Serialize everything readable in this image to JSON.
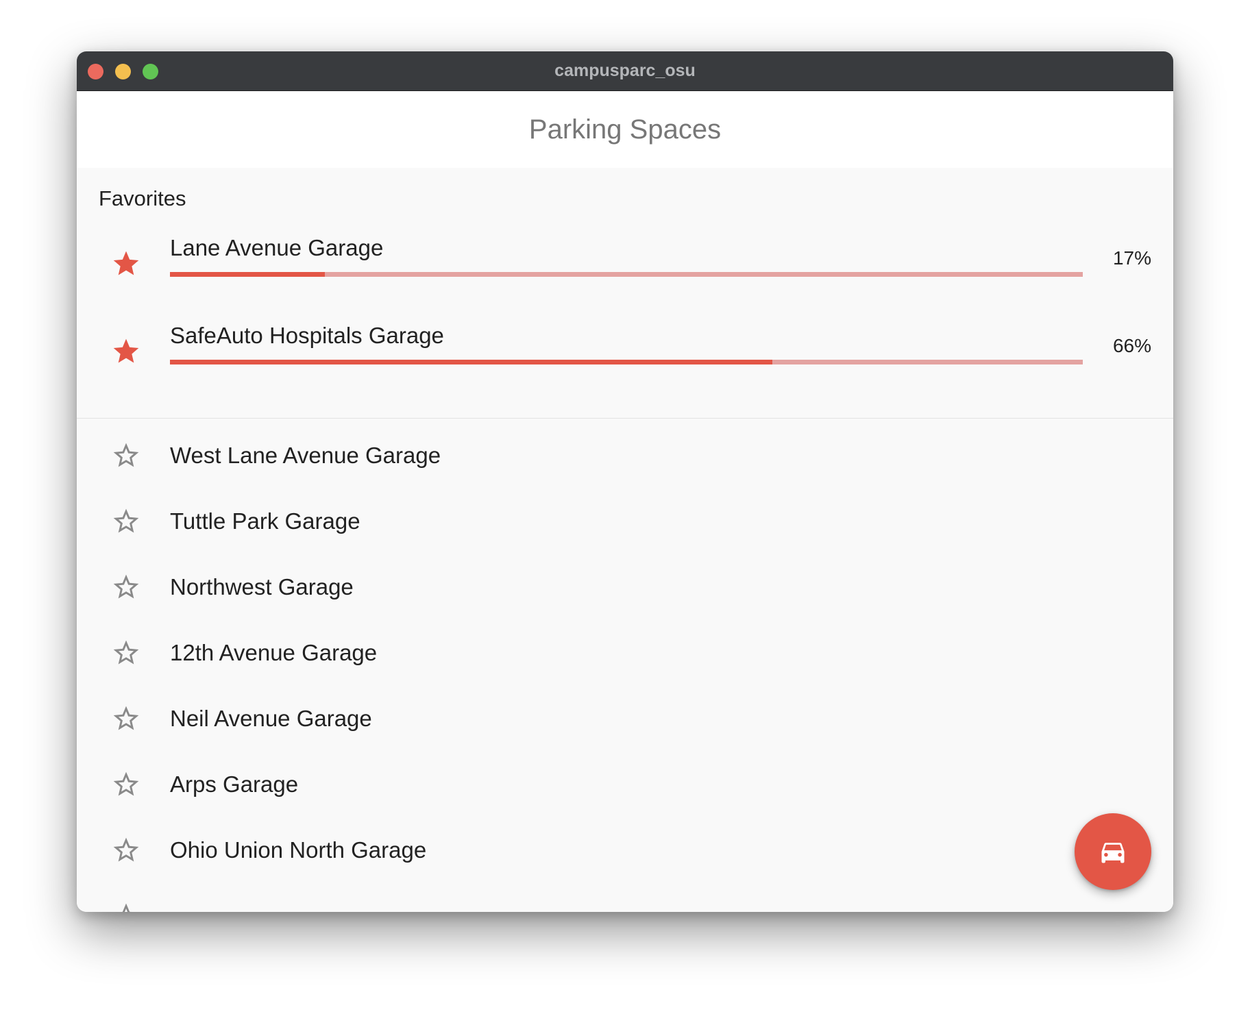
{
  "window": {
    "title": "campusparc_osu",
    "controls": [
      "close",
      "minimize",
      "maximize"
    ],
    "control_colors": {
      "close": "#ec6a5e",
      "minimize": "#f4bf4f",
      "maximize": "#61c554"
    }
  },
  "appbar": {
    "title": "Parking Spaces"
  },
  "colors": {
    "accent": "#e35646",
    "accent_light": "#e4a3a1",
    "star_outline": "#8a8a8a"
  },
  "favorites": {
    "header": "Favorites",
    "items": [
      {
        "name": "Lane Avenue Garage",
        "occupancy_label": "17%",
        "occupancy": 0.17,
        "favorite": true,
        "icon": "star-filled-icon"
      },
      {
        "name": "SafeAuto Hospitals Garage",
        "occupancy_label": "66%",
        "occupancy": 0.66,
        "favorite": true,
        "icon": "star-filled-icon"
      }
    ]
  },
  "garages": [
    {
      "name": "West Lane Avenue Garage",
      "favorite": false,
      "icon": "star-outline-icon"
    },
    {
      "name": "Tuttle Park Garage",
      "favorite": false,
      "icon": "star-outline-icon"
    },
    {
      "name": "Northwest Garage",
      "favorite": false,
      "icon": "star-outline-icon"
    },
    {
      "name": "12th Avenue Garage",
      "favorite": false,
      "icon": "star-outline-icon"
    },
    {
      "name": "Neil Avenue Garage",
      "favorite": false,
      "icon": "star-outline-icon"
    },
    {
      "name": "Arps Garage",
      "favorite": false,
      "icon": "star-outline-icon"
    },
    {
      "name": "Ohio Union North Garage",
      "favorite": false,
      "icon": "star-outline-icon"
    }
  ],
  "fab": {
    "icon": "car-icon"
  }
}
